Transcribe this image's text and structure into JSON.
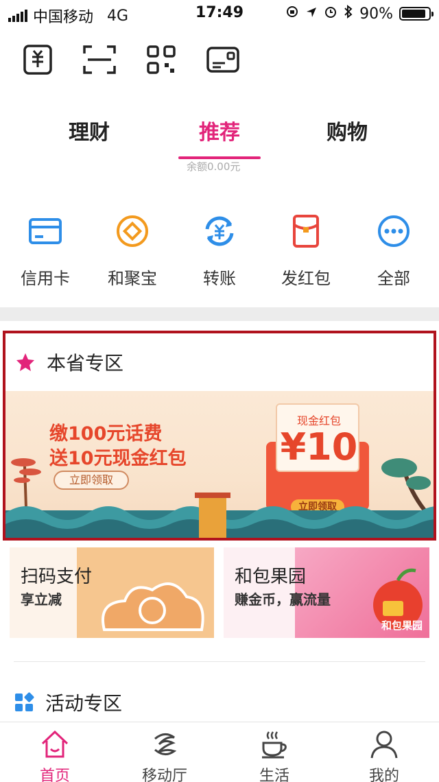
{
  "status_bar": {
    "carrier": "中国移动",
    "network": "4G",
    "time": "17:49",
    "battery": "90%",
    "battery_level": 0.9
  },
  "quick_actions": [
    {
      "name": "payment-code",
      "icon": "yuan-receipt-icon"
    },
    {
      "name": "scan",
      "icon": "scan-icon"
    },
    {
      "name": "qr-code",
      "icon": "qr-code-icon"
    },
    {
      "name": "card",
      "icon": "card-icon"
    }
  ],
  "tabs": [
    {
      "label": "理财",
      "active": false
    },
    {
      "label": "推荐",
      "active": true
    },
    {
      "label": "购物",
      "active": false
    }
  ],
  "balance_text": "余额0.00元",
  "services": [
    {
      "label": "信用卡",
      "icon": "credit-card-icon",
      "color": "#2e8ee8"
    },
    {
      "label": "和聚宝",
      "icon": "coin-icon",
      "color": "#f39a1e"
    },
    {
      "label": "转账",
      "icon": "transfer-icon",
      "color": "#2e8ee8"
    },
    {
      "label": "发红包",
      "icon": "red-packet-icon",
      "color": "#e8453c"
    },
    {
      "label": "全部",
      "icon": "more-icon",
      "color": "#2e8ee8"
    }
  ],
  "province": {
    "title": "本省专区",
    "banner": {
      "line1": "缴100元话费",
      "line2": "送10元现金红包",
      "button": "立即领取",
      "envelope_label": "现金红包",
      "envelope_amount": "¥10",
      "envelope_button": "立即领取"
    }
  },
  "promos": [
    {
      "title": "扫码支付",
      "subtitle": "享立减"
    },
    {
      "title": "和包果园",
      "subtitle": "赚金币，赢流量",
      "badge": "和包果园"
    }
  ],
  "activity": {
    "title": "活动专区"
  },
  "bottom_nav": [
    {
      "label": "首页",
      "icon": "home-icon",
      "active": true
    },
    {
      "label": "移动厅",
      "icon": "china-mobile-icon",
      "active": false
    },
    {
      "label": "生活",
      "icon": "coffee-cup-icon",
      "active": false
    },
    {
      "label": "我的",
      "icon": "user-icon",
      "active": false
    }
  ],
  "colors": {
    "accent": "#e2247a",
    "highlight_border": "#b0121d",
    "banner_text": "#e6462b"
  }
}
